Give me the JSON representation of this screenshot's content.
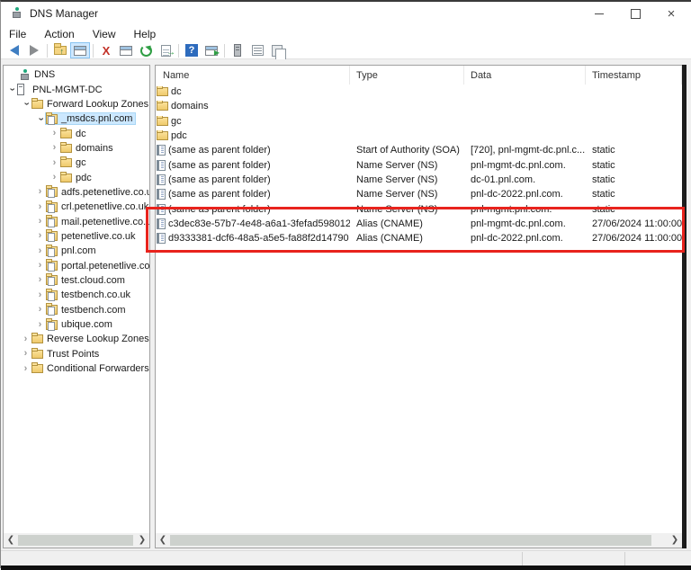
{
  "window": {
    "title": "DNS Manager",
    "controls": {
      "minimize": "minimize",
      "maximize": "maximize",
      "close": "close"
    }
  },
  "menu": {
    "items": [
      {
        "label": "File"
      },
      {
        "label": "Action"
      },
      {
        "label": "View"
      },
      {
        "label": "Help"
      }
    ]
  },
  "toolbar": {
    "buttons": [
      {
        "icon": "back-icon"
      },
      {
        "icon": "forward-icon"
      },
      {
        "icon": "up-one-level-icon"
      },
      {
        "icon": "show-console-tree-icon",
        "selected": true
      },
      {
        "icon": "delete-icon"
      },
      {
        "icon": "properties-icon"
      },
      {
        "icon": "refresh-icon"
      },
      {
        "icon": "export-list-icon"
      },
      {
        "icon": "help-icon"
      },
      {
        "icon": "new-window-icon"
      },
      {
        "icon": "server-icon"
      },
      {
        "icon": "address-list-icon"
      },
      {
        "icon": "copy-icon"
      }
    ]
  },
  "tree": {
    "items": [
      {
        "label": "DNS",
        "level": 0,
        "state": "none",
        "icon": "dns-root",
        "selected": false
      },
      {
        "label": "PNL-MGMT-DC",
        "level": 1,
        "state": "expanded",
        "icon": "server",
        "selected": false
      },
      {
        "label": "Forward Lookup Zones",
        "level": 2,
        "state": "expanded",
        "icon": "folder",
        "selected": false
      },
      {
        "label": "_msdcs.pnl.com",
        "level": 3,
        "state": "expanded",
        "icon": "zone",
        "selected": true
      },
      {
        "label": "dc",
        "level": 4,
        "state": "collapsed",
        "icon": "folder",
        "selected": false
      },
      {
        "label": "domains",
        "level": 4,
        "state": "collapsed",
        "icon": "folder",
        "selected": false
      },
      {
        "label": "gc",
        "level": 4,
        "state": "collapsed",
        "icon": "folder",
        "selected": false
      },
      {
        "label": "pdc",
        "level": 4,
        "state": "collapsed",
        "icon": "folder",
        "selected": false
      },
      {
        "label": "adfs.petenetlive.co.uk",
        "level": 3,
        "state": "collapsed",
        "icon": "zone",
        "selected": false
      },
      {
        "label": "crl.petenetlive.co.uk",
        "level": 3,
        "state": "collapsed",
        "icon": "zone",
        "selected": false
      },
      {
        "label": "mail.petenetlive.co.uk",
        "level": 3,
        "state": "collapsed",
        "icon": "zone",
        "selected": false
      },
      {
        "label": "petenetlive.co.uk",
        "level": 3,
        "state": "collapsed",
        "icon": "zone",
        "selected": false
      },
      {
        "label": "pnl.com",
        "level": 3,
        "state": "collapsed",
        "icon": "zone",
        "selected": false
      },
      {
        "label": "portal.petenetlive.com",
        "level": 3,
        "state": "collapsed",
        "icon": "zone",
        "selected": false
      },
      {
        "label": "test.cloud.com",
        "level": 3,
        "state": "collapsed",
        "icon": "zone",
        "selected": false
      },
      {
        "label": "testbench.co.uk",
        "level": 3,
        "state": "collapsed",
        "icon": "zone",
        "selected": false
      },
      {
        "label": "testbench.com",
        "level": 3,
        "state": "collapsed",
        "icon": "zone",
        "selected": false
      },
      {
        "label": "ubique.com",
        "level": 3,
        "state": "collapsed",
        "icon": "zone",
        "selected": false
      },
      {
        "label": "Reverse Lookup Zones",
        "level": 2,
        "state": "collapsed",
        "icon": "folder",
        "selected": false
      },
      {
        "label": "Trust Points",
        "level": 2,
        "state": "collapsed",
        "icon": "folder",
        "selected": false
      },
      {
        "label": "Conditional Forwarders",
        "level": 2,
        "state": "collapsed",
        "icon": "folder",
        "selected": false
      }
    ]
  },
  "list": {
    "columns": [
      {
        "label": "Name"
      },
      {
        "label": "Type"
      },
      {
        "label": "Data"
      },
      {
        "label": "Timestamp"
      }
    ],
    "rows": [
      {
        "icon": "folder",
        "name": "dc",
        "type": "",
        "data": "",
        "timestamp": ""
      },
      {
        "icon": "folder",
        "name": "domains",
        "type": "",
        "data": "",
        "timestamp": ""
      },
      {
        "icon": "folder",
        "name": "gc",
        "type": "",
        "data": "",
        "timestamp": ""
      },
      {
        "icon": "folder",
        "name": "pdc",
        "type": "",
        "data": "",
        "timestamp": ""
      },
      {
        "icon": "record",
        "name": "(same as parent folder)",
        "type": "Start of Authority (SOA)",
        "data": "[720], pnl-mgmt-dc.pnl.c...",
        "timestamp": "static"
      },
      {
        "icon": "record",
        "name": "(same as parent folder)",
        "type": "Name Server (NS)",
        "data": "pnl-mgmt-dc.pnl.com.",
        "timestamp": "static"
      },
      {
        "icon": "record",
        "name": "(same as parent folder)",
        "type": "Name Server (NS)",
        "data": "dc-01.pnl.com.",
        "timestamp": "static"
      },
      {
        "icon": "record",
        "name": "(same as parent folder)",
        "type": "Name Server (NS)",
        "data": "pnl-dc-2022.pnl.com.",
        "timestamp": "static"
      },
      {
        "icon": "record",
        "name": "(same as parent folder)",
        "type": "Name Server (NS)",
        "data": "pnl-mgmt.pnl.com.",
        "timestamp": "static"
      },
      {
        "icon": "record",
        "name": "c3dec83e-57b7-4e48-a6a1-3fefad598012",
        "type": "Alias (CNAME)",
        "data": "pnl-mgmt-dc.pnl.com.",
        "timestamp": "27/06/2024 11:00:00"
      },
      {
        "icon": "record",
        "name": "d9333381-dcf6-48a5-a5e5-fa88f2d14790",
        "type": "Alias (CNAME)",
        "data": "pnl-dc-2022.pnl.com.",
        "timestamp": "27/06/2024 11:00:00"
      }
    ]
  },
  "annotation": {
    "shape": "rectangle",
    "color": "#e8231d",
    "highlights": "two Alias (CNAME) rows"
  },
  "colors": {
    "selection": "#cce8ff",
    "annotation_red": "#e8231d",
    "folder_yellow": "#f5d583"
  }
}
